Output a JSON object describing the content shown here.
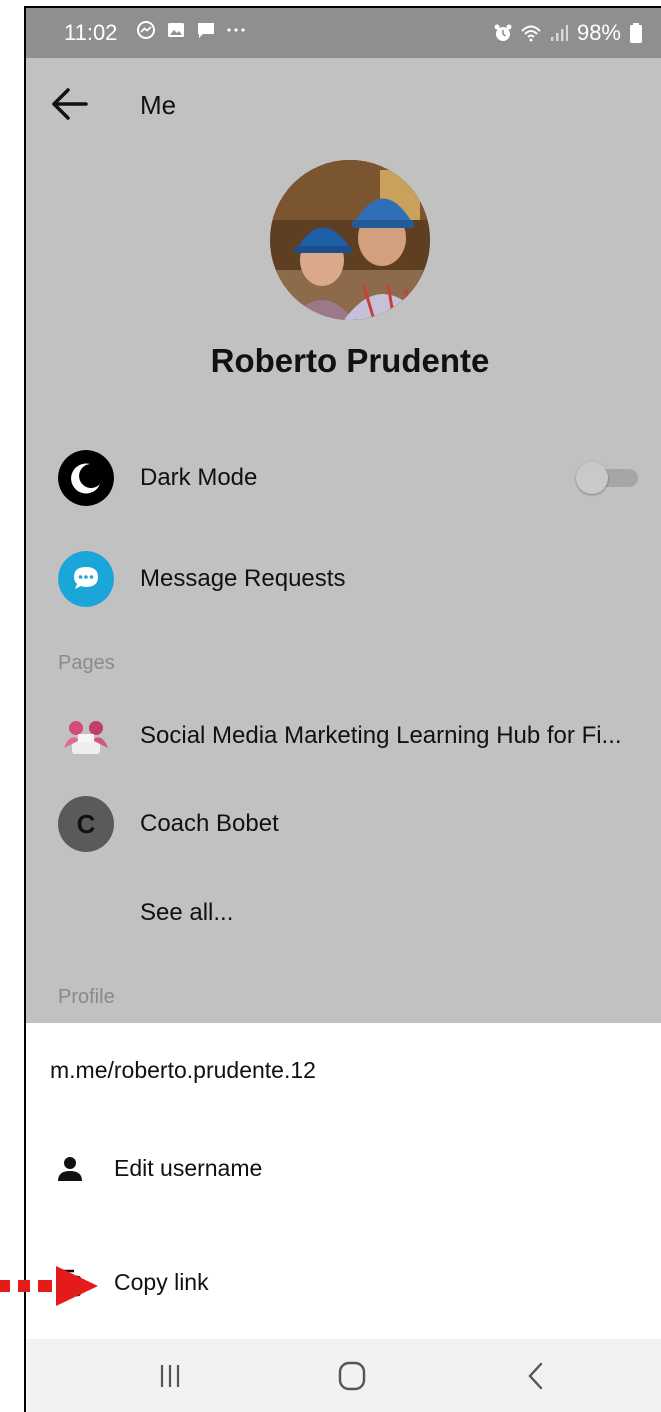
{
  "status_bar": {
    "time": "11:02",
    "battery": "98%"
  },
  "header": {
    "title": "Me"
  },
  "profile": {
    "name": "Roberto Prudente"
  },
  "settings": {
    "dark_mode_label": "Dark Mode",
    "dark_mode_on": false,
    "message_requests_label": "Message Requests"
  },
  "pages": {
    "section_label": "Pages",
    "items": [
      {
        "label": "Social Media Marketing Learning Hub for Fi..."
      },
      {
        "label": "Coach Bobet",
        "avatar_letter": "C"
      }
    ],
    "see_all_label": "See all..."
  },
  "profile_section": {
    "section_label": "Profile"
  },
  "sheet": {
    "url": "m.me/roberto.prudente.12",
    "edit_username_label": "Edit username",
    "copy_link_label": "Copy link"
  },
  "colors": {
    "message_requests_icon": "#1aa6d8",
    "coach_avatar": "#5a5a5a",
    "annotation_arrow": "#e31b1b"
  }
}
